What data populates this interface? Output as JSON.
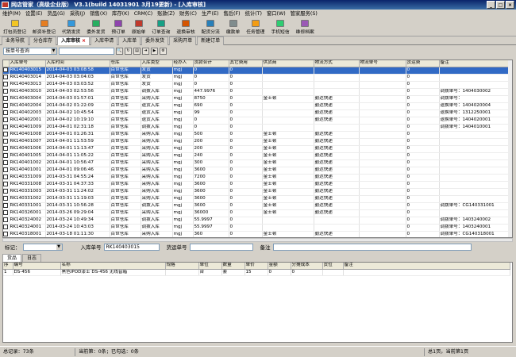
{
  "window": {
    "title": "网店管家（高级企业版） V3.1(build 14031901 3月19更新) - [入库审核]"
  },
  "menu": [
    "维护(M)",
    "设置(E)",
    "货品(G)",
    "采购(J)",
    "销售(X)",
    "库存(K)",
    "CRM(C)",
    "账款(Z)",
    "财务(C)",
    "生产(E)",
    "售后(F)",
    "统计(T)",
    "窗口(W)",
    "管家服务(S)"
  ],
  "toolbar": [
    "打包员登记",
    "邮资补登记",
    "代销发货",
    "委外发货",
    "预订单",
    "原始单",
    "订单查询",
    "退换审核",
    "配货分流",
    "缴款单",
    "任务管理",
    "手机短信",
    "维修档案"
  ],
  "doc_tabs": [
    "业务导航",
    "分仓库存",
    "入库审核",
    "入库申请",
    "入库单",
    "委外发货",
    "采购开单",
    "新建订单"
  ],
  "active_tab": "入库审核",
  "filter": {
    "selected": "按单号查询"
  },
  "grid": {
    "columns": [
      "入库单号",
      "入库时间",
      "仓库",
      "入库类型",
      "经办人",
      "货款合计",
      "其它费用",
      "供货商",
      "物流方式",
      "物流单号",
      "货运费",
      "备注"
    ],
    "rows": [
      [
        "RK140403015",
        "2014-04-03  03:08:58",
        "百世仓库",
        "发货",
        "mgj",
        "0",
        "0",
        "",
        "",
        "",
        "0",
        ""
      ],
      [
        "RK140403014",
        "2014-04-03  03:04:03",
        "百世仓库",
        "发货",
        "mgj",
        "0",
        "0",
        "",
        "",
        "",
        "0",
        ""
      ],
      [
        "RK140403013",
        "2014-04-03  03:03:52",
        "百世仓库",
        "发货",
        "mgj",
        "0",
        "0",
        "",
        "",
        "",
        "0",
        ""
      ],
      [
        "RK140403010",
        "2014-04-03  02:53:56",
        "百世仓库",
        "调拨入库",
        "mgj",
        "447.9976",
        "0",
        "",
        "",
        "",
        "0",
        "调拨单号：1404030002"
      ],
      [
        "RK140403004",
        "2014-04-03  01:57:01",
        "百世仓库",
        "采购入库",
        "mgj",
        "8750",
        "0",
        "金士顿",
        "勤达快递",
        "",
        "0",
        "调拨单号："
      ],
      [
        "RK140402004",
        "2014-04-02  01:22:09",
        "百世仓库",
        "退货入库",
        "mgj",
        "690",
        "0",
        "",
        "勤达快递",
        "",
        "0",
        "退换单号：1404020004"
      ],
      [
        "RK140402003",
        "2014-04-02  10:45:54",
        "百世仓库",
        "退货入库",
        "mgj",
        "99",
        "0",
        "",
        "勤达快递",
        "",
        "0",
        "退换单号：1312250001"
      ],
      [
        "RK140402001",
        "2014-04-02  10:19:10",
        "百世仓库",
        "退货入库",
        "mgj",
        "0",
        "0",
        "",
        "勤达快递",
        "",
        "0",
        "退换单号：1404020001"
      ],
      [
        "RK140401009",
        "2014-04-01  02:31:18",
        "百世仓库",
        "调拨入库",
        "mgj",
        "0",
        "0",
        "",
        "",
        "",
        "0",
        "调拨单号：1404010001"
      ],
      [
        "RK140401008",
        "2014-04-01  01:26:31",
        "百世仓库",
        "采购入库",
        "mgj",
        "500",
        "0",
        "金士顿",
        "勤达快递",
        "",
        "0",
        ""
      ],
      [
        "RK140401007",
        "2014-04-01  11:53:59",
        "百世仓库",
        "采购入库",
        "mgj",
        "200",
        "0",
        "金士顿",
        "勤达快递",
        "",
        "0",
        ""
      ],
      [
        "RK140401006",
        "2014-04-01  11:13:47",
        "百世仓库",
        "采购入库",
        "mgj",
        "200",
        "0",
        "金士顿",
        "勤达快递",
        "",
        "0",
        ""
      ],
      [
        "RK140401005",
        "2014-04-01  11:05:22",
        "百世仓库",
        "采购入库",
        "mgj",
        "240",
        "0",
        "金士顿",
        "勤达快递",
        "",
        "0",
        ""
      ],
      [
        "RK140401002",
        "2014-04-01  10:56:47",
        "百世仓库",
        "采购入库",
        "mgj",
        "300",
        "0",
        "金士顿",
        "勤达快递",
        "",
        "0",
        ""
      ],
      [
        "RK140401001",
        "2014-04-01  09:06:46",
        "百世仓库",
        "采购入库",
        "mgj",
        "3600",
        "0",
        "金士顿",
        "勤达快递",
        "",
        "0",
        ""
      ],
      [
        "RK140331009",
        "2014-03-31  04:55:24",
        "百世仓库",
        "采购入库",
        "mgj",
        "7200",
        "0",
        "金士顿",
        "勤达快递",
        "",
        "0",
        ""
      ],
      [
        "RK140331008",
        "2014-03-31  04:37:33",
        "百世仓库",
        "采购入库",
        "mgj",
        "3600",
        "0",
        "金士顿",
        "勤达快递",
        "",
        "0",
        ""
      ],
      [
        "RK140331003",
        "2014-03-31  11:24:02",
        "百世仓库",
        "采购入库",
        "mgj",
        "3600",
        "0",
        "金士顿",
        "勤达快递",
        "",
        "0",
        ""
      ],
      [
        "RK140331002",
        "2014-03-31  11:19:03",
        "百世仓库",
        "采购入库",
        "mgj",
        "3600",
        "0",
        "金士顿",
        "勤达快递",
        "",
        "0",
        ""
      ],
      [
        "RK140331001",
        "2014-03-31  10:56:28",
        "百世仓库",
        "调拨入库",
        "mgj",
        "3600",
        "0",
        "金士顿",
        "勤达快递",
        "",
        "0",
        "调拨单号：CG140331001"
      ],
      [
        "RK140326001",
        "2014-03-26  09:29:04",
        "百世仓库",
        "采购入库",
        "mgj",
        "36000",
        "0",
        "金士顿",
        "勤达快递",
        "",
        "0",
        ""
      ],
      [
        "RK140324002",
        "2014-03-24  10:49:34",
        "百世仓库",
        "调拨入库",
        "mgj",
        "55.9997",
        "0",
        "",
        "",
        "",
        "0",
        "调拨单号：1403240002"
      ],
      [
        "RK140324001",
        "2014-03-24  10:43:03",
        "百世仓库",
        "调拨入库",
        "mgj",
        "55.9997",
        "0",
        "",
        "",
        "",
        "0",
        "调拨单号：1403240001"
      ],
      [
        "RK140318001",
        "2014-03-18  01:11:30",
        "百世仓库",
        "采购入库",
        "mgj",
        "360",
        "0",
        "金士顿",
        "勤达快递",
        "",
        "0",
        "调拨单号：CG140318001"
      ]
    ]
  },
  "markbar": {
    "label": "标记：",
    "inbound_label": "入库单号",
    "inbound_value": "RK140403015",
    "supplier_label": "货运单号",
    "remark_label": "备注"
  },
  "detail_tabs": [
    "货品",
    "日志"
  ],
  "detail": {
    "columns": [
      "序",
      "编号",
      "名称",
      "规格",
      "单位",
      "数量",
      "单价",
      "金额",
      "分摊成本",
      "货位",
      "备注"
    ],
    "rows": [
      [
        "1",
        "DS-456",
        "黑色IPOD漆士 DS-456 无线音箱",
        "",
        "台",
        "套",
        "15",
        "0",
        "0",
        "",
        ""
      ]
    ]
  },
  "status": {
    "total": "总记录：73条",
    "current": "当前第：0条；已勾选：0条",
    "page": "总1页，当前第1页"
  }
}
